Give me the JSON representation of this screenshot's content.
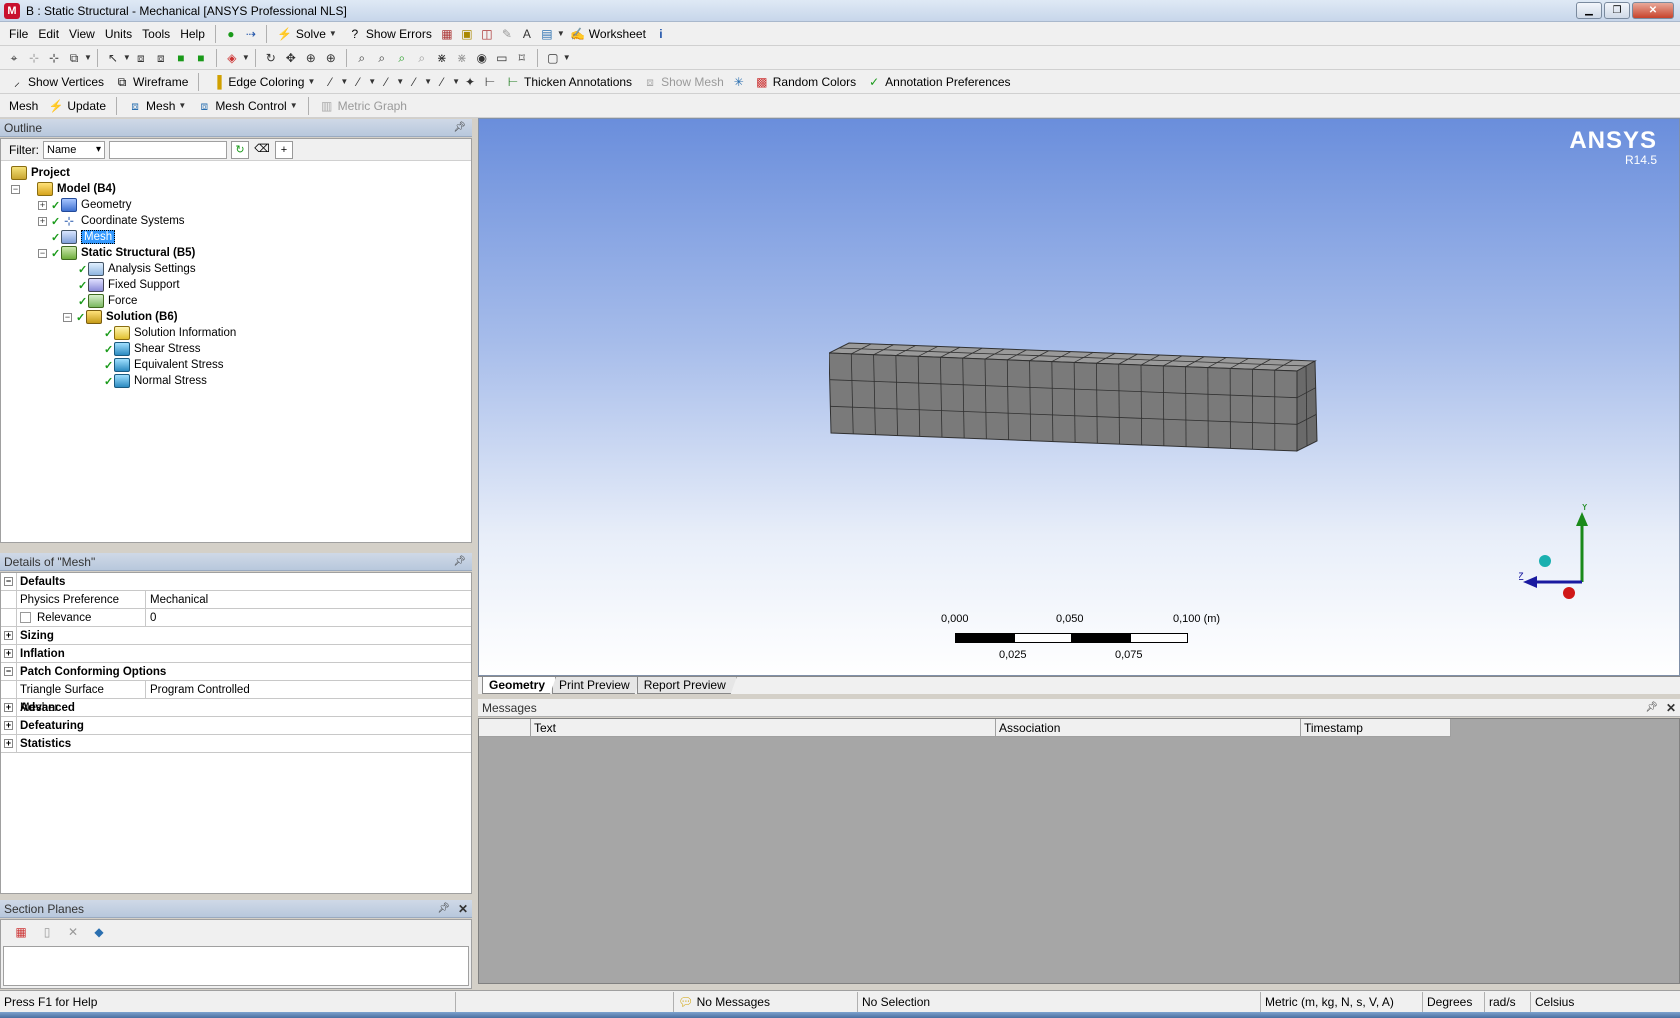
{
  "window": {
    "title": "B : Static Structural - Mechanical [ANSYS Professional NLS]",
    "app_icon_letter": "M"
  },
  "menubar": {
    "items": [
      "File",
      "Edit",
      "View",
      "Units",
      "Tools",
      "Help"
    ],
    "solve_label": "Solve",
    "show_errors_label": "Show Errors",
    "worksheet_label": "Worksheet"
  },
  "toolbar3": {
    "show_vertices": "Show Vertices",
    "wireframe": "Wireframe",
    "edge_coloring": "Edge Coloring",
    "thicken_annotations": "Thicken Annotations",
    "show_mesh": "Show Mesh",
    "random_colors": "Random Colors",
    "annotation_preferences": "Annotation Preferences"
  },
  "toolbar4": {
    "mesh_label": "Mesh",
    "update_label": "Update",
    "mesh_dropdown": "Mesh",
    "mesh_control": "Mesh Control",
    "metric_graph": "Metric Graph"
  },
  "outline": {
    "header": "Outline",
    "filter_label": "Filter:",
    "filter_value": "Name",
    "tree": {
      "project": "Project",
      "model": "Model (B4)",
      "geometry": "Geometry",
      "coordinate_systems": "Coordinate Systems",
      "mesh": "Mesh",
      "static_structural": "Static Structural (B5)",
      "analysis_settings": "Analysis Settings",
      "fixed_support": "Fixed Support",
      "force": "Force",
      "solution": "Solution (B6)",
      "solution_information": "Solution Information",
      "shear_stress": "Shear Stress",
      "equivalent_stress": "Equivalent Stress",
      "normal_stress": "Normal Stress"
    }
  },
  "details": {
    "header": "Details of \"Mesh\"",
    "defaults": "Defaults",
    "physics_preference_label": "Physics Preference",
    "physics_preference_value": "Mechanical",
    "relevance_label": "Relevance",
    "relevance_value": "0",
    "sizing": "Sizing",
    "inflation": "Inflation",
    "patch_conforming": "Patch Conforming Options",
    "triangle_mesher_label": "Triangle Surface Mesher",
    "triangle_mesher_value": "Program Controlled",
    "advanced": "Advanced",
    "defeaturing": "Defeaturing",
    "statistics": "Statistics"
  },
  "section_planes": {
    "header": "Section Planes"
  },
  "viewport": {
    "brand": "ANSYS",
    "version": "R14.5",
    "scale": {
      "top_labels": [
        "0,000",
        "0,050",
        "0,100 (m)"
      ],
      "bottom_labels": [
        "0,025",
        "0,075"
      ]
    },
    "axes": {
      "y": "Y",
      "z": "Z"
    }
  },
  "tabs": [
    "Geometry",
    "Print Preview",
    "Report Preview"
  ],
  "messages": {
    "header": "Messages",
    "columns": [
      "Text",
      "Association",
      "Timestamp"
    ]
  },
  "statusbar": {
    "help": "Press F1 for Help",
    "messages": "No Messages",
    "selection": "No Selection",
    "units": "Metric (m, kg, N, s, V, A)",
    "angle": "Degrees",
    "rotational": "rad/s",
    "temperature": "Celsius"
  },
  "colors": {
    "selection": "#3399ff",
    "mesh_fill": "#787878",
    "check": "#1a9a1a"
  }
}
